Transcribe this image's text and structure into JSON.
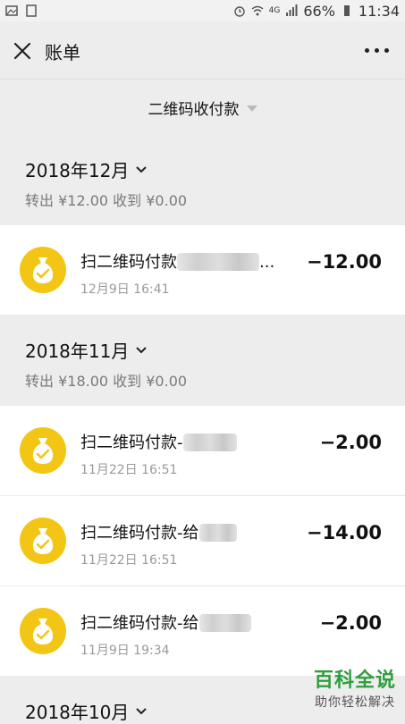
{
  "status_bar": {
    "battery": "66%",
    "time": "11:34",
    "network": "4G"
  },
  "navbar": {
    "title": "账单"
  },
  "filter": {
    "label": "二维码收付款"
  },
  "months": [
    {
      "title": "2018年12月",
      "summary": "转出 ¥12.00 收到 ¥0.00",
      "transactions": [
        {
          "title": "扫二维码付款",
          "suffix": "...",
          "time": "12月9日 16:41",
          "amount": "−12.00"
        }
      ]
    },
    {
      "title": "2018年11月",
      "summary": "转出 ¥18.00 收到 ¥0.00",
      "transactions": [
        {
          "title": "扫二维码付款-",
          "suffix": "",
          "time": "11月22日 16:51",
          "amount": "−2.00"
        },
        {
          "title": "扫二维码付款-给",
          "suffix": "",
          "time": "11月22日 16:51",
          "amount": "−14.00"
        },
        {
          "title": "扫二维码付款-给",
          "suffix": "",
          "time": "11月9日 19:34",
          "amount": "−2.00"
        }
      ]
    },
    {
      "title": "2018年10月"
    }
  ],
  "watermark": {
    "main": "百科全说",
    "sub": "助你轻松解决"
  },
  "colors": {
    "coin": "#f3c615",
    "background": "#ededed",
    "watermark": "#2e9e3e"
  },
  "icons": [
    "close-icon",
    "more-icon",
    "chevron-down-icon",
    "money-bag-icon"
  ]
}
